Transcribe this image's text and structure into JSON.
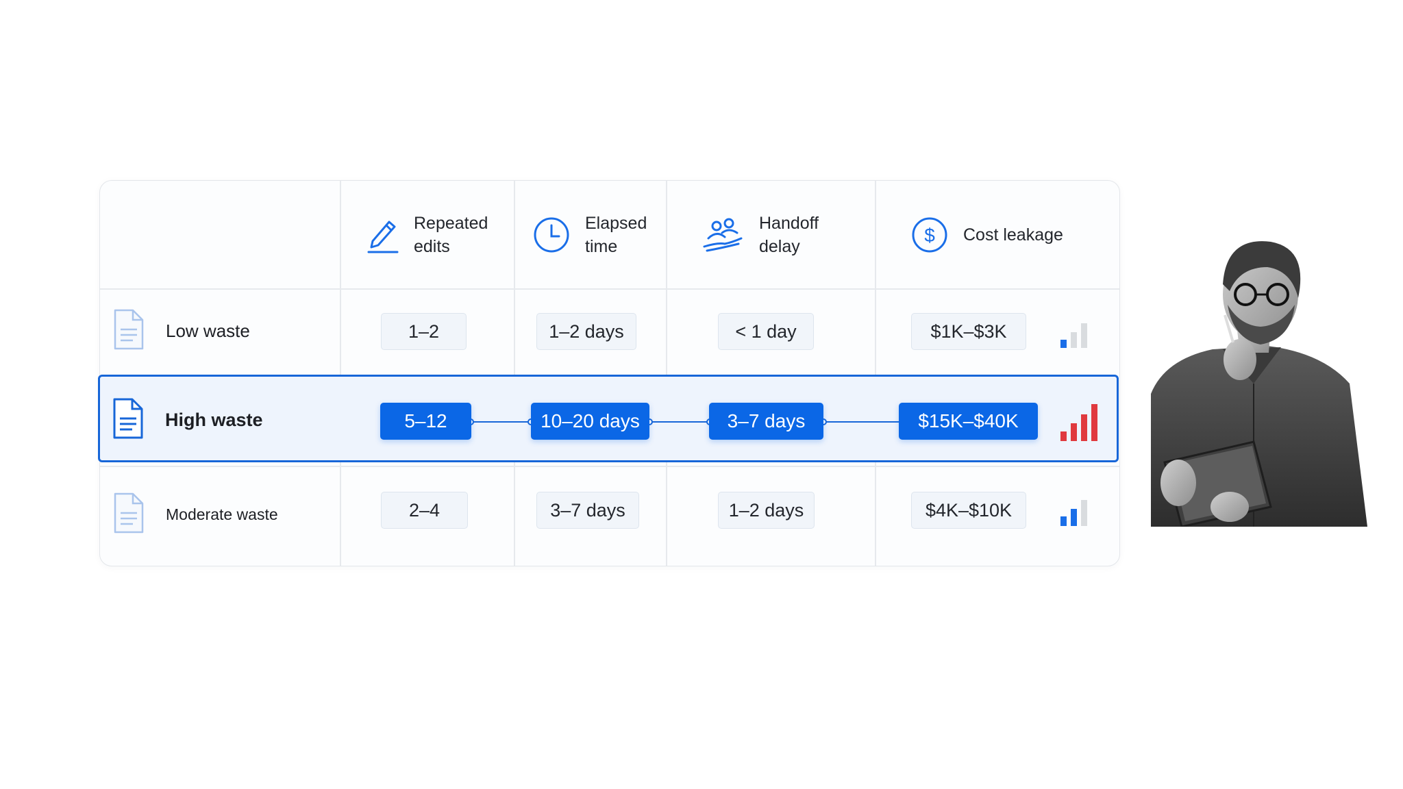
{
  "headers": [
    {
      "label": "Repeated\nedits",
      "icon": "pencil-icon"
    },
    {
      "label": "Elapsed\ntime",
      "icon": "clock-icon"
    },
    {
      "label": "Handoff\ndelay",
      "icon": "people-handoff-icon"
    },
    {
      "label": "Cost leakage",
      "icon": "dollar-circle-icon"
    }
  ],
  "rows": [
    {
      "label": "Low waste",
      "values": [
        "1–2",
        "1–2 days",
        "< 1 day",
        "$1K–$3K"
      ],
      "signal_level": 1,
      "signal_max": 3,
      "highlighted": false
    },
    {
      "label": "High waste",
      "values": [
        "5–12",
        "10–20 days",
        "3–7 days",
        "$15K–$40K"
      ],
      "signal_level": 4,
      "signal_max": 4,
      "highlighted": true
    },
    {
      "label": "Moderate waste",
      "values": [
        "2–4",
        "3–7 days",
        "1–2 days",
        "$4K–$10K"
      ],
      "signal_level": 2,
      "signal_max": 3,
      "highlighted": false
    }
  ],
  "colors": {
    "accent": "#0b67e6",
    "highlight_border": "#1766d8",
    "highlight_bg": "#eef4fd",
    "signal_active_blue": "#1a6ee8",
    "signal_high_red": "#e0393e",
    "signal_inactive": "#d9dcdf"
  },
  "image": {
    "description": "person-thinking-holding-tablet"
  }
}
